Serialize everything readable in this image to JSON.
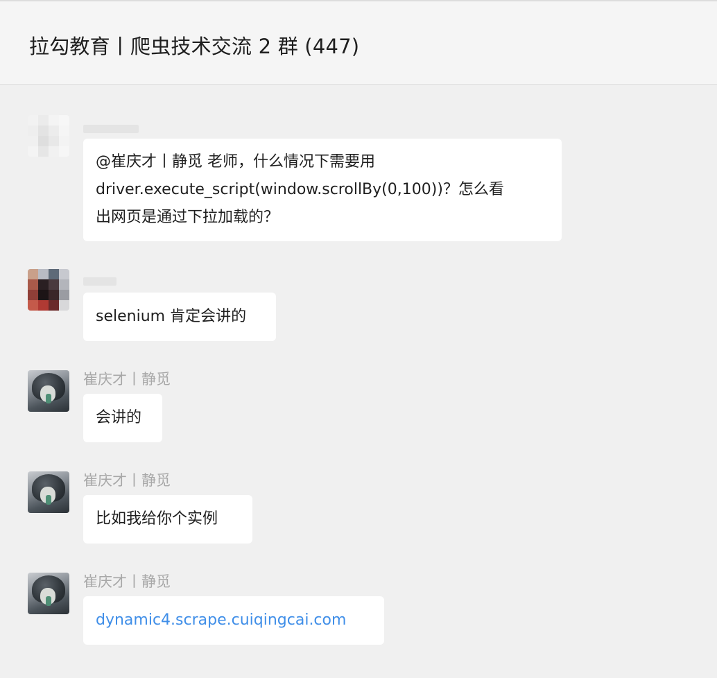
{
  "header": {
    "title": "拉勾教育丨爬虫技术交流 2 群 (447)"
  },
  "messages": [
    {
      "sender": "",
      "lines": [
        "@崔庆才丨静觅 老师，什么情况下需要用",
        "driver.execute_script(window.scrollBy(0,100))？怎么看",
        "出网页是通过下拉加载的？"
      ]
    },
    {
      "sender": "",
      "lines": [
        "selenium 肯定会讲的"
      ]
    },
    {
      "sender": "崔庆才丨静觅",
      "lines": [
        "会讲的"
      ]
    },
    {
      "sender": "崔庆才丨静觅",
      "lines": [
        "比如我给你个实例"
      ]
    },
    {
      "sender": "崔庆才丨静觅",
      "lines": [
        "dynamic4.scrape.cuiqingcai.com"
      ]
    }
  ],
  "colors": {
    "link": "#3f8ee8",
    "bubble_bg": "#ffffff",
    "chat_bg": "#f0f0f0",
    "sender": "#a8a8a8"
  }
}
